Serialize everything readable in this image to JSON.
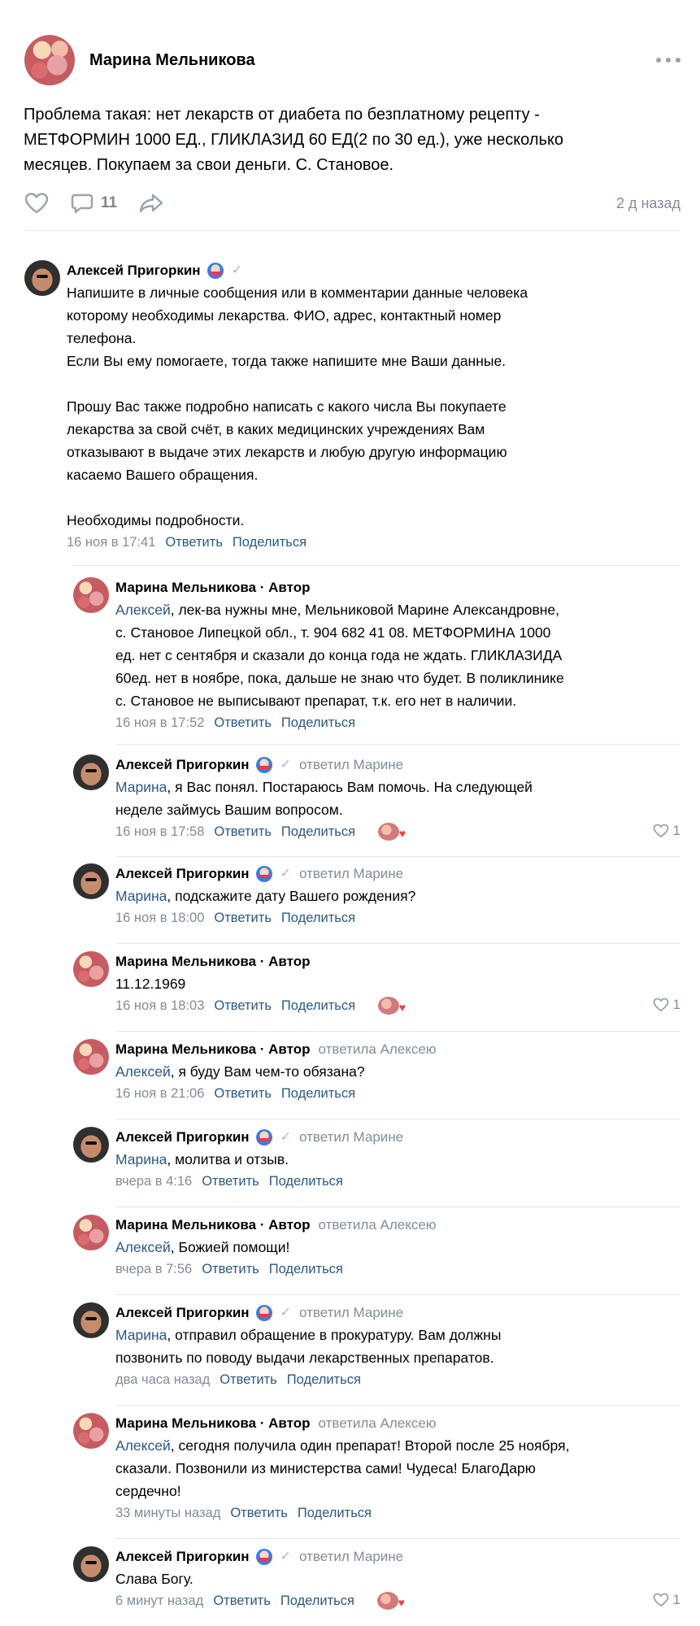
{
  "post": {
    "author": "Марина Мельникова",
    "text": "Проблема такая: нет лекарств от диабета по безплатному рецепту -\nМЕТФОРМИН 1000 ЕД., ГЛИКЛАЗИД 60 ЕД(2 по 30 ед.), уже несколько\nмесяцев. Покупаем за свои деньги. С. Становое.",
    "comments_count": "11",
    "time": "2 д назад"
  },
  "actions": {
    "reply": "Ответить",
    "share": "Поделиться"
  },
  "comments": [
    {
      "author": "Алексей Пригоркин",
      "text": "Напишите в личные сообщения или в комментарии данные человека\nкоторому необходимы лекарства. ФИО, адрес, контактный номер\nтелефона.\nЕсли Вы ему помогаете, тогда также напишите мне Ваши данные.\n\nПрошу Вас также подробно написать с какого числа Вы покупаете\nлекарства за свой счёт, в каких медицинских учреждениях Вам\nотказывают в выдаче этих лекарств и любую другую информацию\nкасаемо Вашего обращения.\n\nНеобходимы подробности.",
      "time": "16 ноя в 17:41"
    },
    {
      "author": "Марина Мельникова · Автор",
      "mention": "Алексей",
      "text": ", лек-ва нужны мне, Мельниковой Марине Александровне,\nс. Становое Липецкой обл., т. 904 682 41 08. МЕТФОРМИНА 1000\nед. нет с сентября и сказали до конца года не ждать. ГЛИКЛАЗИДА\n60ед. нет в ноябре, пока, дальше не знаю что будет. В поликлинике\nс. Становое не выписывают препарат, т.к. его нет в наличии.",
      "time": "16 ноя в 17:52"
    },
    {
      "author": "Алексей Пригоркин",
      "reply_to": "ответил Марине",
      "mention": "Марина",
      "text": ", я Вас понял. Постараюсь Вам помочь. На следующей\nнеделе займусь Вашим вопросом.",
      "time": "16 ноя в 17:58",
      "likes": "1"
    },
    {
      "author": "Алексей Пригоркин",
      "reply_to": "ответил Марине",
      "mention": "Марина",
      "text": ", подскажите дату Вашего рождения?",
      "time": "16 ноя в 18:00"
    },
    {
      "author": "Марина Мельникова · Автор",
      "text": "11.12.1969",
      "time": "16 ноя в 18:03",
      "likes": "1"
    },
    {
      "author": "Марина Мельникова · Автор",
      "reply_to": "ответила Алексею",
      "mention": "Алексей",
      "text": ", я буду Вам чем-то обязана?",
      "time": "16 ноя в 21:06"
    },
    {
      "author": "Алексей Пригоркин",
      "reply_to": "ответил Марине",
      "mention": "Марина",
      "text": ", молитва и отзыв.",
      "time": "вчера в 4:16"
    },
    {
      "author": "Марина Мельникова · Автор",
      "reply_to": "ответила Алексею",
      "mention": "Алексей",
      "text": ", Божией помощи!",
      "time": "вчера в 7:56"
    },
    {
      "author": "Алексей Пригоркин",
      "reply_to": "ответил Марине",
      "mention": "Марина",
      "text": ", отправил обращение в прокуратуру. Вам должны\nпозвонить по поводу выдачи лекарственных препаратов.",
      "time": "два часа назад"
    },
    {
      "author": "Марина Мельникова · Автор",
      "reply_to": "ответила Алексею",
      "mention": "Алексей",
      "text": ", сегодня получила один препарат! Второй после 25 ноября,\nсказали. Позвонили из министерства сами! Чудеса! БлагоДарю\nсердечно!",
      "time": "33 минуты назад"
    },
    {
      "author": "Алексей Пригоркин",
      "reply_to": "ответил Марине",
      "text": "Слава Богу.",
      "time": "6 минут назад",
      "likes": "1"
    }
  ]
}
